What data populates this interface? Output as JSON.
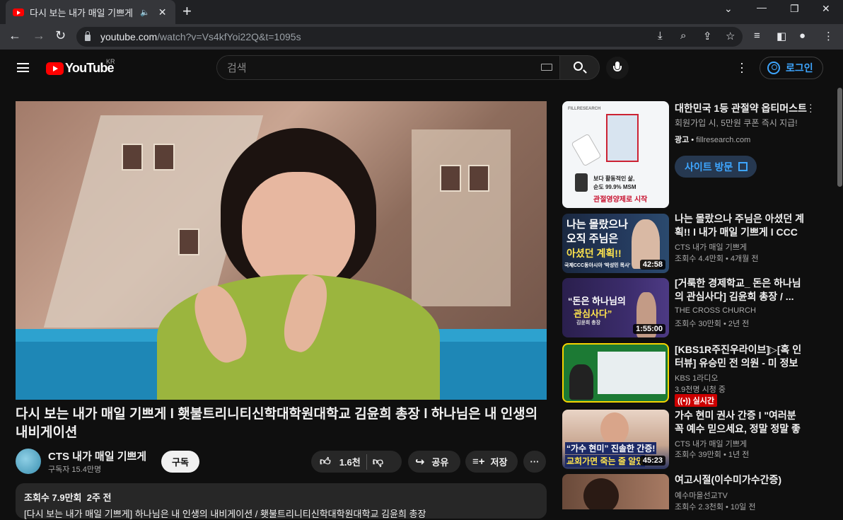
{
  "browser": {
    "tab_title": "다시 보는 내가 매일 기쁘게",
    "url_host": "youtube.com",
    "url_path": "/watch?v=Vs4kfYoi22Q&t=1095s"
  },
  "masthead": {
    "logo_text": "YouTube",
    "region": "KR",
    "search_placeholder": "검색",
    "login_label": "로그인"
  },
  "video": {
    "title": "다시 보는 내가 매일 기쁘게 l 횃불트리니티신학대학원대학교 김윤희 총장 l 하나님은 내 인생의 내비게이션",
    "channel_name": "CTS 내가 매일 기쁘게",
    "subscribers": "구독자 15.4만명",
    "subscribe_label": "구독",
    "likes": "1.6천",
    "share_label": "공유",
    "save_label": "저장",
    "views": "조회수 7.9만회",
    "age": "2주 전",
    "description": "[다시 보는 내가 매일 기쁘게] 하나님은 내 인생의 내비게이션 / 횃불트리니티신학대학원대학교 김윤희 총장"
  },
  "ad": {
    "title": "대한민국 1등 관절약 옵티머스트",
    "subtitle": "회원가입 시, 5만원 쿠폰 즉시 지급!",
    "label": "광고",
    "domain": "fillresearch.com",
    "cta": "사이트 방문",
    "thumb_brand": "FILLRESEARCH",
    "thumb_line1": "보다 활동적인 삶,",
    "thumb_line2": "순도 99.9% MSM",
    "thumb_line3": "관절영양제로 시작"
  },
  "recommendations": [
    {
      "title": "나는 몰랐으나 주님은 아셨던 계획!! l 내가 매일 기쁘게 l CCC글...",
      "channel": "CTS 내가 매일 기쁘게",
      "meta": "조회수 4.4만회 • 4개월 전",
      "duration": "42:58",
      "thumb_text1": "나는 몰랐으나",
      "thumb_text2": "오직 주님은",
      "thumb_text3": "아셨던 계획!!",
      "thumb_text4": "국제CCC동아시아 '박성민 목사'"
    },
    {
      "title": "[거룩한 경제학교_ 돈은 하나님의 관심사다] 김윤희 총장 / ...",
      "channel": "THE CROSS CHURCH",
      "meta": "조회수 30만회 • 2년 전",
      "duration": "1:55:00",
      "thumb_text1": "“돈은 하나님의",
      "thumb_text2": "관심사다”",
      "thumb_text3": "김윤희 총장"
    },
    {
      "title": "[KBS1R주진우라이브]▷[혹 인터뷰] 유승민 전 의원 - 미 정보 기...",
      "channel": "KBS 1라디오",
      "meta": "3.9천명 시청 중",
      "live": "실시간"
    },
    {
      "title": "가수 현미 권사 간증 l \"여러분 꼭 예수 믿으세요, 정말 정말 좋아...",
      "channel": "CTS 내가 매일 기쁘게",
      "meta": "조회수 39만회 • 1년 전",
      "duration": "45:23",
      "thumb_text1": "“가수 현미” 진솔한 간증!",
      "thumb_text2": "교회가면 죽는 줄 알았"
    },
    {
      "title": "여고시절(이수미가수간증)",
      "channel": "예수마을선교TV",
      "meta": "조회수 2.3천회 • 10일 전"
    }
  ]
}
